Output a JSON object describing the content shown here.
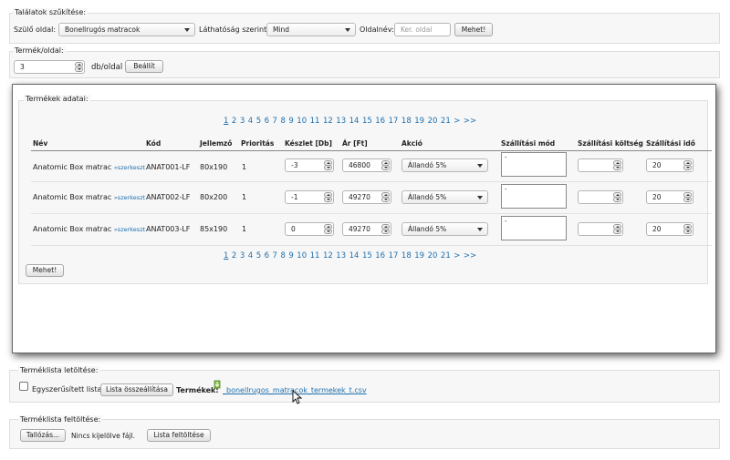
{
  "filter": {
    "legend": "Találatok szűkítése:",
    "parent_label": "Szülő oldal:",
    "parent_value": "Bonellrugós matracok",
    "visibility_label": "Láthatóság szerint:",
    "visibility_value": "Mind",
    "pagename_label": "Oldalnév:",
    "pagename_placeholder": "Ker. oldal",
    "go_label": "Mehet!"
  },
  "per_page": {
    "legend": "Termék/oldal:",
    "value": "3",
    "unit": "db/oldal",
    "set_label": "Beállít"
  },
  "products": {
    "legend": "Termékek adatai:",
    "pages": [
      "1",
      "2",
      "3",
      "4",
      "5",
      "6",
      "7",
      "8",
      "9",
      "10",
      "11",
      "12",
      "13",
      "14",
      "15",
      "16",
      "17",
      "18",
      "19",
      "20",
      "21",
      ">",
      ">>"
    ],
    "columns": {
      "name": "Név",
      "code": "Kód",
      "feature": "Jellemző",
      "priority": "Prioritás",
      "stock": "Készlet [Db]",
      "price": "Ár [Ft]",
      "promo": "Akció",
      "shipping_method": "Szállítási mód",
      "shipping_cost": "Szállítási költség",
      "shipping_time": "Szállítási idő"
    },
    "rows": [
      {
        "name": "Anatomic Box matrac",
        "edit": "»szerkeszt",
        "code": "ANAT001-LF",
        "feature": "80x190",
        "priority": "1",
        "stock": "-3",
        "price": "46800",
        "promo": "Állandó 5%",
        "shipping_method": "-",
        "shipping_cost": "",
        "shipping_time": "20"
      },
      {
        "name": "Anatomic Box matrac",
        "edit": "»szerkeszt",
        "code": "ANAT002-LF",
        "feature": "80x200",
        "priority": "1",
        "stock": "-1",
        "price": "49270",
        "promo": "Állandó 5%",
        "shipping_method": "-",
        "shipping_cost": "",
        "shipping_time": "20"
      },
      {
        "name": "Anatomic Box matrac",
        "edit": "»szerkeszt",
        "code": "ANAT003-LF",
        "feature": "85x190",
        "priority": "1",
        "stock": "0",
        "price": "49270",
        "promo": "Állandó 5%",
        "shipping_method": "-",
        "shipping_cost": "",
        "shipping_time": "20"
      }
    ],
    "go_label": "Mehet!"
  },
  "download": {
    "legend": "Terméklista letöltése:",
    "simplified_label": "Egyszerűsített lista",
    "compile_label": "Lista összeállítása",
    "products_label": "Termékek:",
    "file_link": "_bonellrugos_matracok_termekek_t.csv"
  },
  "upload": {
    "legend": "Terméklista feltöltése:",
    "browse_label": "Tallózás...",
    "no_file": "Nincs kijelölve fájl.",
    "upload_label": "Lista feltöltése"
  }
}
